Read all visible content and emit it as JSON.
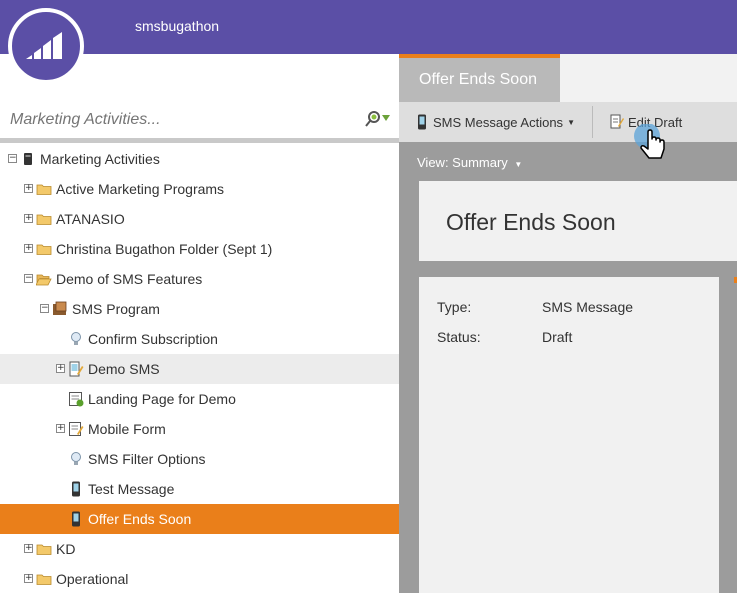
{
  "header": {
    "workspace": "smsbugathon"
  },
  "search": {
    "placeholder": "Marketing Activities..."
  },
  "tree": [
    {
      "label": "Marketing Activities",
      "level": 0,
      "expander": "minus",
      "icon": "root-db-icon"
    },
    {
      "label": "Active Marketing Programs",
      "level": 1,
      "expander": "plus",
      "icon": "folder-icon"
    },
    {
      "label": "ATANASIO",
      "level": 1,
      "expander": "plus",
      "icon": "folder-icon"
    },
    {
      "label": "Christina Bugathon Folder (Sept 1)",
      "level": 1,
      "expander": "plus",
      "icon": "folder-icon"
    },
    {
      "label": "Demo of SMS Features",
      "level": 1,
      "expander": "minus",
      "icon": "folder-open-icon"
    },
    {
      "label": "SMS Program",
      "level": 2,
      "expander": "minus",
      "icon": "program-icon"
    },
    {
      "label": "Confirm Subscription",
      "level": 3,
      "expander": "none",
      "icon": "lightbulb-icon"
    },
    {
      "label": "Demo SMS",
      "level": 3,
      "expander": "plus",
      "icon": "sms-draft-icon",
      "highlight": true
    },
    {
      "label": "Landing Page for Demo",
      "level": 3,
      "expander": "none",
      "icon": "landing-page-icon"
    },
    {
      "label": "Mobile Form",
      "level": 3,
      "expander": "plus",
      "icon": "form-icon"
    },
    {
      "label": "SMS Filter Options",
      "level": 3,
      "expander": "none",
      "icon": "lightbulb-icon"
    },
    {
      "label": "Test Message",
      "level": 3,
      "expander": "none",
      "icon": "phone-icon"
    },
    {
      "label": "Offer Ends Soon",
      "level": 3,
      "expander": "none",
      "icon": "phone-icon",
      "selected": true
    },
    {
      "label": "KD",
      "level": 1,
      "expander": "plus",
      "icon": "folder-icon"
    },
    {
      "label": "Operational",
      "level": 1,
      "expander": "plus",
      "icon": "folder-icon"
    }
  ],
  "tab": {
    "label": "Offer Ends Soon"
  },
  "toolbar": {
    "actions_label": "SMS Message Actions",
    "edit_label": "Edit Draft"
  },
  "view": {
    "label": "View: Summary"
  },
  "asset": {
    "title": "Offer Ends Soon",
    "type_label": "Type:",
    "type_value": "SMS Message",
    "status_label": "Status:",
    "status_value": "Draft"
  },
  "colors": {
    "brand": "#5b4fa6",
    "accent": "#ea7f1a",
    "panel": "#9c9c9c"
  }
}
